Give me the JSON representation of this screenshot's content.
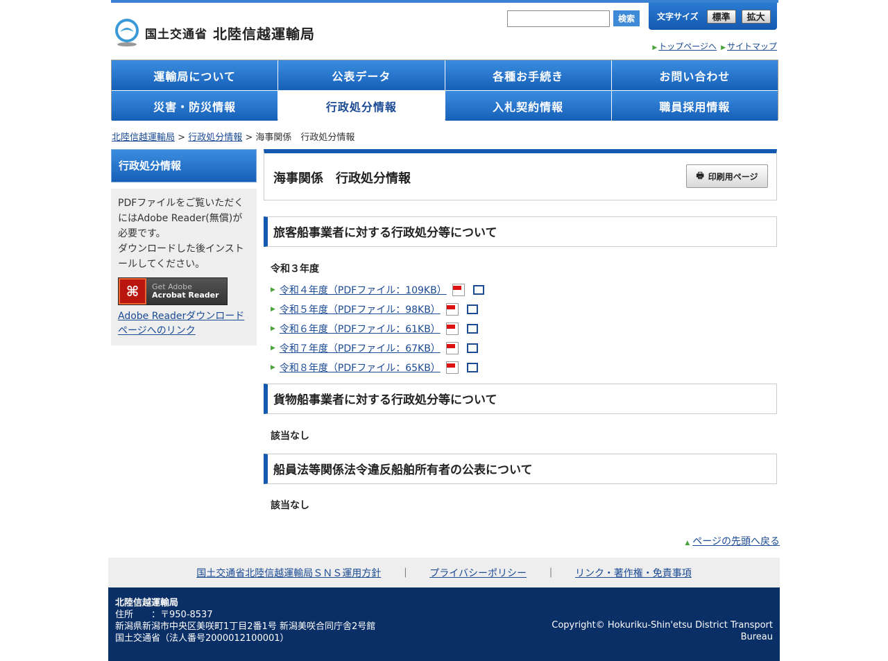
{
  "header": {
    "logo_text1": "国土交通省",
    "logo_text2": "北陸信越運輸局",
    "search_button": "検索",
    "font_size_label": "文字サイズ",
    "font_standard": "標準",
    "font_large": "拡大",
    "top_link": "トップページへ",
    "sitemap_link": "サイトマップ"
  },
  "gnav": [
    "運輸局について",
    "公表データ",
    "各種お手続き",
    "お問い合わせ",
    "災害・防災情報",
    "行政処分情報",
    "入札契約情報",
    "職員採用情報"
  ],
  "breadcrumb": {
    "home": "北陸信越運輸局",
    "parent": "行政処分情報",
    "current": "海事関係　行政処分情報",
    "sep": " > "
  },
  "sidebar": {
    "title": "行政処分情報",
    "pdf_note": "PDFファイルをご覧いただくにはAdobe Reader(無償)が必要です。\nダウンロードした後インストールしてください。",
    "acrobat_line1": "Get Adobe",
    "acrobat_line2": "Acrobat Reader",
    "download_link": "Adobe Readerダウンロードページへのリンク"
  },
  "main": {
    "page_title": "海事関係　行政処分情報",
    "print_button": "印刷用ページ",
    "section1_title": "旅客船事業者に対する行政処分等について",
    "section1_year": "令和３年度",
    "section1_links": [
      "令和４年度（PDFファイル：109KB）",
      "令和５年度（PDFファイル：98KB）",
      "令和６年度（PDFファイル：61KB）",
      "令和７年度（PDFファイル：67KB）",
      "令和８年度（PDFファイル：65KB）"
    ],
    "section2_title": "貨物船事業者に対する行政処分等について",
    "section2_body": "該当なし",
    "section3_title": "船員法等関係法令違反船舶所有者の公表について",
    "section3_body": "該当なし",
    "back_to_top": "ページの先頭へ戻る"
  },
  "footer": {
    "links": [
      "国土交通省北陸信越運輸局ＳＮＳ運用方針",
      "プライバシーポリシー",
      "リンク・著作権・免責事項"
    ],
    "separator": "｜",
    "org": "北陸信越運輸局",
    "address_line1": "住所　　：〒950-8537",
    "address_line2": "新潟県新潟市中央区美咲町1丁目2番1号 新潟美咲合同庁舎2号館",
    "address_line3": "国土交通省（法人番号2000012100001）",
    "copyright_line1": "Copyright© Hokuriku-Shin'etsu District Transport",
    "copyright_line2": "Bureau"
  }
}
